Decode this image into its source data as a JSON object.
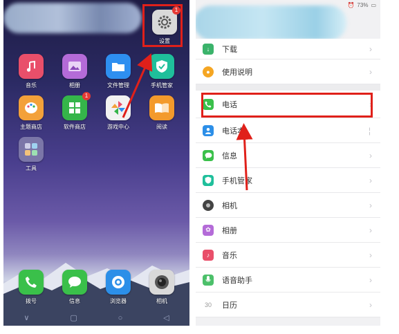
{
  "left_screen": {
    "apps": [
      {
        "label": "音乐",
        "icon": "music-note-icon",
        "color": "#e94f6a"
      },
      {
        "label": "相册",
        "icon": "photo-gallery-icon",
        "color": "#b46bd8"
      },
      {
        "label": "文件管理",
        "icon": "folder-icon",
        "color": "#2e8ff0"
      },
      {
        "label": "手机管家",
        "icon": "shield-check-icon",
        "color": "#1fbf9b"
      },
      {
        "label": "主题商店",
        "icon": "palette-icon",
        "color": "#f3a13a"
      },
      {
        "label": "软件商店",
        "icon": "app-grid-icon",
        "color": "#35b54a",
        "badge": "1"
      },
      {
        "label": "游戏中心",
        "icon": "pinwheel-icon",
        "color": "#f2f2f2"
      },
      {
        "label": "阅读",
        "icon": "book-icon",
        "color": "#f39a2c"
      },
      {
        "label": "工具",
        "icon": "tools-folder-icon",
        "color": "#7b76a8"
      }
    ],
    "settings_app": {
      "label": "设置",
      "icon": "gear-icon",
      "badge": "1"
    },
    "dock": [
      {
        "label": "拨号",
        "icon": "phone-icon",
        "color": "#3ac04a"
      },
      {
        "label": "信息",
        "icon": "message-bubble-icon",
        "color": "#3ac04a"
      },
      {
        "label": "浏览器",
        "icon": "browser-icon",
        "color": "#2c8fe8"
      },
      {
        "label": "相机",
        "icon": "camera-icon",
        "color": "#d9d9d9"
      }
    ]
  },
  "right_screen": {
    "status": {
      "battery": "73%"
    },
    "rows": [
      {
        "label": "下载",
        "icon": "download-icon",
        "color": "#3bb36b"
      },
      {
        "label": "使用说明",
        "icon": "bulb-icon",
        "color": "#f5a623"
      },
      {
        "label": "电话",
        "icon": "phone-icon",
        "color": "#3ac04a"
      },
      {
        "label": "电话本",
        "icon": "contacts-icon",
        "color": "#2c8fe8"
      },
      {
        "label": "信息",
        "icon": "message-bubble-icon",
        "color": "#3ac04a"
      },
      {
        "label": "手机管家",
        "icon": "shield-check-icon",
        "color": "#1fbf9b"
      },
      {
        "label": "相机",
        "icon": "camera-icon",
        "color": "#444444"
      },
      {
        "label": "相册",
        "icon": "photo-gallery-icon",
        "color": "#b46bd8"
      },
      {
        "label": "音乐",
        "icon": "music-note-icon",
        "color": "#e94f6a"
      },
      {
        "label": "语音助手",
        "icon": "voice-assistant-icon",
        "color": "#4cc06a"
      },
      {
        "label": "日历",
        "icon": "calendar-icon",
        "color": "#9a9a9a",
        "icon_text": "30"
      }
    ]
  }
}
